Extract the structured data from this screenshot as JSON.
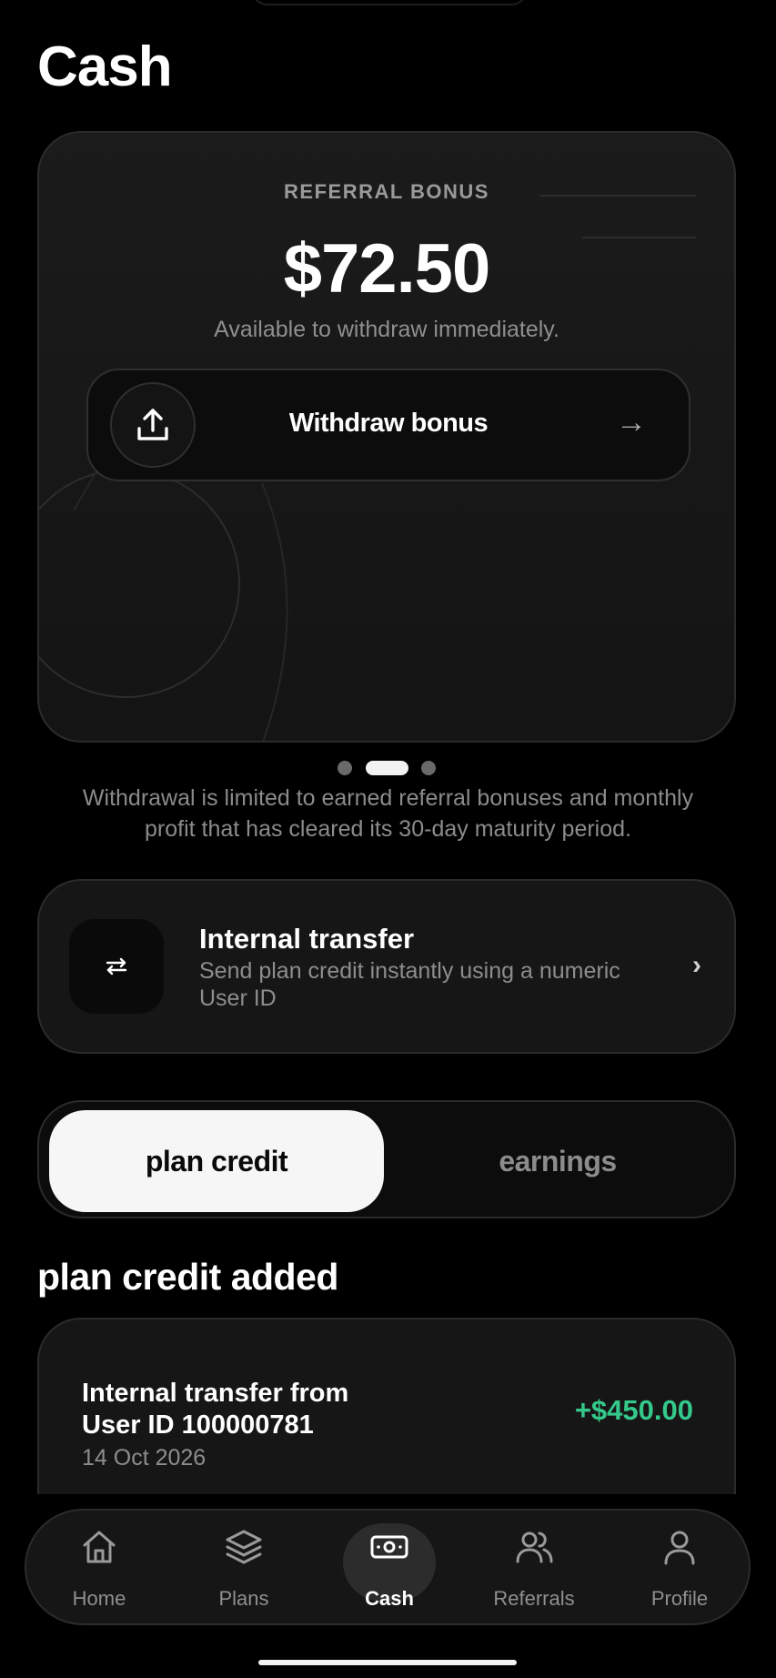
{
  "page": {
    "title": "Cash"
  },
  "bonus_card": {
    "label": "REFERRAL BONUS",
    "amount": "$72.50",
    "subtitle": "Available to withdraw immediately.",
    "withdraw_label": "Withdraw bonus",
    "withdraw_arrow": "→",
    "withdraw_icon": "upload-icon"
  },
  "pager": {
    "count": 3,
    "active_index": 1
  },
  "note": "Withdrawal is limited to earned referral bonuses and monthly profit that has cleared its 30-day maturity period.",
  "internal_transfer": {
    "title": "Internal transfer",
    "subtitle": "Send plan credit instantly using a numeric User ID",
    "icon": "swap-arrows-icon",
    "chevron": "›"
  },
  "tabs": {
    "items": [
      {
        "label": "plan credit",
        "active": true
      },
      {
        "label": "earnings",
        "active": false
      }
    ]
  },
  "section": {
    "title": "plan credit added"
  },
  "transactions": [
    {
      "title": "Internal transfer from User ID 100000781",
      "date": "14 Oct 2026",
      "amount": "+$450.00"
    }
  ],
  "nav": {
    "items": [
      {
        "label": "Home",
        "icon": "home-icon",
        "active": false
      },
      {
        "label": "Plans",
        "icon": "layers-icon",
        "active": false
      },
      {
        "label": "Cash",
        "icon": "cash-icon",
        "active": true
      },
      {
        "label": "Referrals",
        "icon": "users-icon",
        "active": false
      },
      {
        "label": "Profile",
        "icon": "user-icon",
        "active": false
      }
    ]
  },
  "colors": {
    "background": "#000000",
    "card": "#161616",
    "positive": "#34c88a",
    "muted_text": "#8d8d8d"
  }
}
